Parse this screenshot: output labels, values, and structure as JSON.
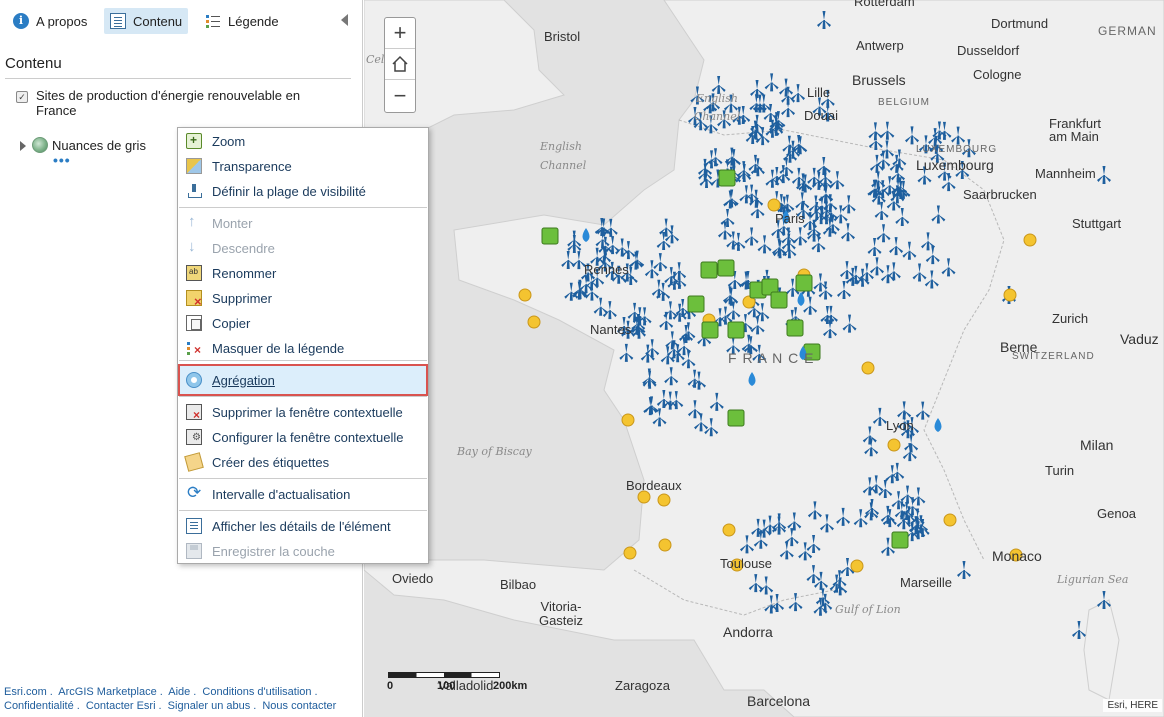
{
  "tabs": {
    "about": "A propos",
    "content": "Contenu",
    "legend": "Légende"
  },
  "panel": {
    "title": "Contenu",
    "layers": [
      {
        "label": "Sites de production d'énergie renouvelable en France",
        "checked": true
      },
      {
        "label": "Nuances de gris"
      }
    ],
    "more_dots": "•••"
  },
  "context_menu": {
    "items": [
      {
        "label": "Zoom",
        "icon": "zoom-icon",
        "enabled": true
      },
      {
        "label": "Transparence",
        "icon": "transparency-icon",
        "enabled": true
      },
      {
        "label": "Définir la plage de visibilité",
        "icon": "visibility-range-icon",
        "enabled": true
      },
      {
        "label": "Monter",
        "icon": "arrow-up-icon",
        "enabled": false
      },
      {
        "label": "Descendre",
        "icon": "arrow-down-icon",
        "enabled": false
      },
      {
        "label": "Renommer",
        "icon": "rename-icon",
        "enabled": true
      },
      {
        "label": "Supprimer",
        "icon": "delete-icon",
        "enabled": true
      },
      {
        "label": "Copier",
        "icon": "copy-icon",
        "enabled": true
      },
      {
        "label": "Masquer de la légende",
        "icon": "hide-legend-icon",
        "enabled": true
      },
      {
        "label": "Agrégation",
        "icon": "aggregation-icon",
        "enabled": true,
        "highlighted": true
      },
      {
        "label": "Supprimer la fenêtre contextuelle",
        "icon": "remove-popup-icon",
        "enabled": true
      },
      {
        "label": "Configurer la fenêtre contextuelle",
        "icon": "configure-popup-icon",
        "enabled": true
      },
      {
        "label": "Créer des étiquettes",
        "icon": "create-labels-icon",
        "enabled": true
      },
      {
        "label": "Intervalle d'actualisation",
        "icon": "refresh-icon",
        "enabled": true
      },
      {
        "label": "Afficher les détails de l'élément",
        "icon": "item-details-icon",
        "enabled": true
      },
      {
        "label": "Enregistrer la couche",
        "icon": "save-layer-icon",
        "enabled": false
      }
    ]
  },
  "footer": {
    "links": [
      "Esri.com",
      "ArcGIS Marketplace",
      "Aide",
      "Conditions d'utilisation",
      "Confidentialité",
      "Contacter Esri",
      "Signaler un abus",
      "Nous contacter"
    ]
  },
  "map": {
    "zoom_in": "+",
    "zoom_out": "−",
    "scale": {
      "zero": "0",
      "hundred": "100",
      "two_hundred": "200km"
    },
    "attribution": "Esri, HERE",
    "labels": {
      "rotterdam": "Rotterdam",
      "dortmund": "Dortmund",
      "germany": "GERMAN",
      "bristol": "Bristol",
      "antwerp": "Antwerp",
      "dusseldorf": "Dusseldorf",
      "celtic": "Celt",
      "brussels": "Brussels",
      "cologne": "Cologne",
      "english_channel_1": "English",
      "lille": "Lille",
      "belgium": "BELGIUM",
      "channel_1": "Channel",
      "douai": "Douai",
      "frankfurt": "Frankfurt am Main",
      "english_2": "English",
      "luxembourg_country": "LUXEMBOURG",
      "channel_2": "Channel",
      "luxembourg": "Luxembourg",
      "mannheim": "Mannheim",
      "saarbrucken": "Saarbrucken",
      "paris": "Paris",
      "stuttgart": "Stuttgart",
      "rennes": "Rennes",
      "zurich": "Zurich",
      "vaduz": "Vaduz",
      "nantes": "Nantes",
      "france": "F R A N C E",
      "berne": "Berne",
      "switzerland": "SWITZERLAND",
      "lyon": "Lyon",
      "milan": "Milan",
      "bay_of_biscay": "Bay of Biscay",
      "turin": "Turin",
      "bordeaux": "Bordeaux",
      "genoa": "Genoa",
      "toulouse": "Toulouse",
      "monaco": "Monaco",
      "oviedo": "Oviedo",
      "marseille": "Marseille",
      "ligurian_sea": "Ligurian Sea",
      "bilbao": "Bilbao",
      "gulf_of_lion": "Gulf of Lion",
      "vitoria": "Vitoria-Gasteiz",
      "andorra": "Andorra",
      "valladolid": "Valladolid",
      "zaragoza": "Zaragoza",
      "barcelona": "Barcelona"
    }
  },
  "colors": {
    "wind_marker": "#1e5f9e",
    "solar_marker": "#f4c430",
    "biomass_marker": "#6cbf3c",
    "hydro_marker": "#2a8ad8",
    "land": "#efefef",
    "sea": "#e2e2e2",
    "menu_highlight_border": "#d9534f"
  }
}
